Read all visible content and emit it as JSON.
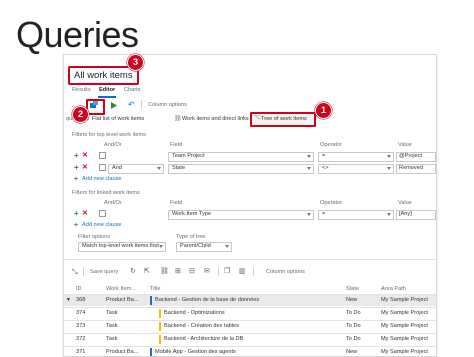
{
  "slide": {
    "title": "Queries"
  },
  "query": {
    "name": "All work items"
  },
  "tabs": [
    "Results",
    "Editor",
    "Charts"
  ],
  "toolbar_top": {
    "column_options": "Column options"
  },
  "query_types": [
    {
      "label": "Flat list of work items"
    },
    {
      "label": "Work items and direct links"
    },
    {
      "label": "Tree of work items"
    }
  ],
  "partial_label": "query",
  "filters_top": {
    "heading": "Filters for top level work items",
    "headers": {
      "andor": "And/Or",
      "field": "Field",
      "operator": "Operator",
      "value": "Value"
    },
    "rows": [
      {
        "andor": "",
        "field": "Team Project",
        "operator": "=",
        "value": "@Project"
      },
      {
        "andor": "And",
        "field": "State",
        "operator": "<>",
        "value": "Removed"
      }
    ],
    "add_clause": "Add new clause"
  },
  "filters_linked": {
    "heading": "Filters for linked work items",
    "headers": {
      "andor": "And/Or",
      "field": "Field",
      "operator": "Operator",
      "value": "Value"
    },
    "rows": [
      {
        "andor": "",
        "field": "Work Item Type",
        "operator": "=",
        "value": "[Any]"
      }
    ],
    "add_clause": "Add new clause"
  },
  "filter_options": {
    "label": "Filter options",
    "value": "Match top-level work items first"
  },
  "type_of_tree": {
    "label": "Type of tree",
    "value": "Parent/Child"
  },
  "results_toolbar": {
    "save_query": "Save query",
    "column_options": "Column options"
  },
  "results": {
    "headers": [
      "ID",
      "Work Item...",
      "Title",
      "State",
      "Area Path"
    ],
    "rows": [
      {
        "id": "368",
        "type": "Product Ba...",
        "title": "Backend - Gestion de la base de données",
        "state": "New",
        "area": "My Sample Project",
        "bar_color": "#1a6fbf",
        "selected": true
      },
      {
        "id": "374",
        "type": "Task",
        "title": "Backend - Optimizations",
        "state": "To Do",
        "area": "My Sample Project",
        "bar_color": "#f2c200",
        "selected": false
      },
      {
        "id": "373",
        "type": "Task",
        "title": "Backend - Création des tables",
        "state": "To Do",
        "area": "My Sample Project",
        "bar_color": "#f2c200",
        "selected": false
      },
      {
        "id": "372",
        "type": "Task",
        "title": "Backend - Architecture de la DB",
        "state": "To Do",
        "area": "My Sample Project",
        "bar_color": "#f2c200",
        "selected": false
      },
      {
        "id": "371",
        "type": "Product Ba...",
        "title": "Mobile App - Gestion des agents",
        "state": "New",
        "area": "My Sample Project",
        "bar_color": "#1a6fbf",
        "selected": false
      }
    ]
  },
  "callouts": [
    "1",
    "2",
    "3"
  ],
  "colors": {
    "accent": "#0f6fc6",
    "callout": "#d0021b",
    "add": "#2e8b3e"
  }
}
